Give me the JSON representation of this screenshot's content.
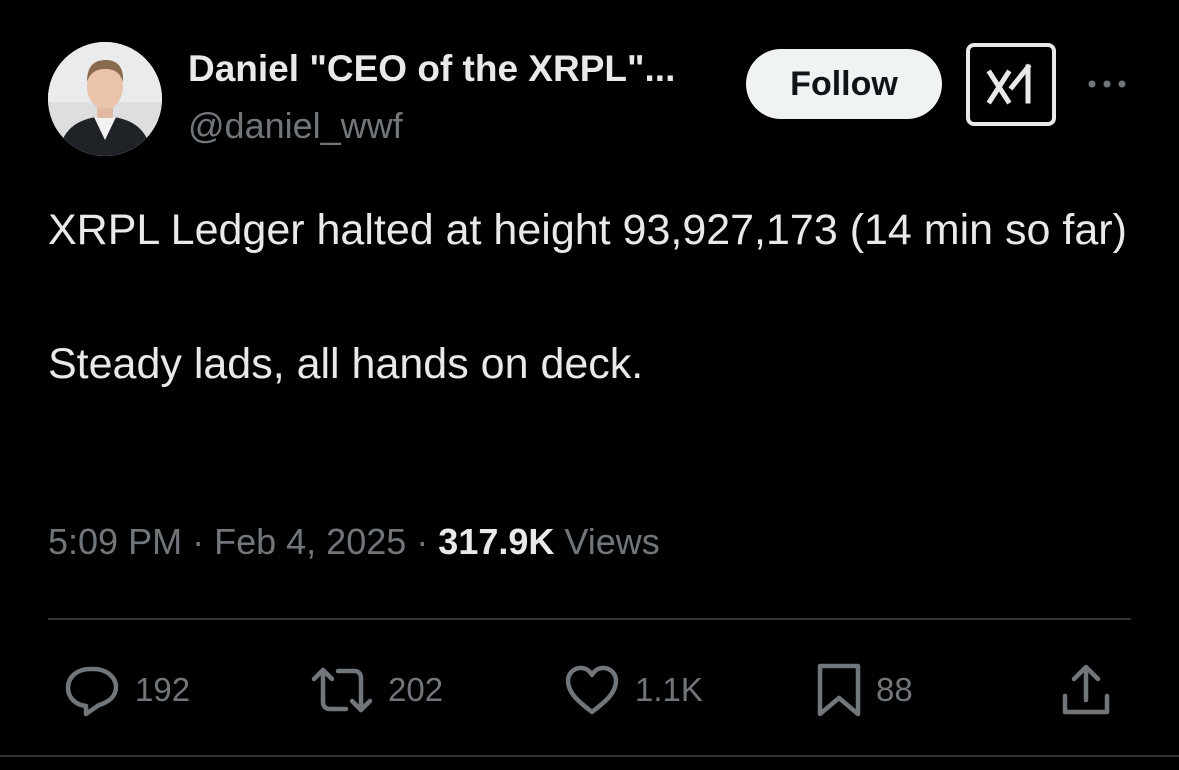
{
  "author": {
    "display_name": "Daniel \"CEO of the XRPL\"...",
    "handle": "@daniel_wwf",
    "avatar_icon": "user-avatar-photo"
  },
  "header": {
    "follow_label": "Follow",
    "grok_icon": "grok-icon",
    "more_icon": "more-horizontal-icon"
  },
  "tweet": {
    "text_line1": "XRPL Ledger halted at height 93,927,173 (14 min so far)",
    "text_line2": "Steady lads, all hands on deck."
  },
  "meta": {
    "time": "5:09 PM",
    "separator": "·",
    "date": "Feb 4, 2025",
    "views_count": "317.9K",
    "views_label": "Views"
  },
  "actions": {
    "reply": {
      "icon": "reply-icon",
      "count": "192"
    },
    "retweet": {
      "icon": "retweet-icon",
      "count": "202"
    },
    "like": {
      "icon": "heart-icon",
      "count": "1.1K"
    },
    "bookmark": {
      "icon": "bookmark-icon",
      "count": "88"
    },
    "share": {
      "icon": "share-icon"
    }
  },
  "colors": {
    "background": "#000000",
    "text_primary": "#e7e9ea",
    "text_secondary": "#71767b",
    "divider": "#2f3336",
    "follow_bg": "#eff3f4",
    "follow_text": "#0f1419"
  }
}
